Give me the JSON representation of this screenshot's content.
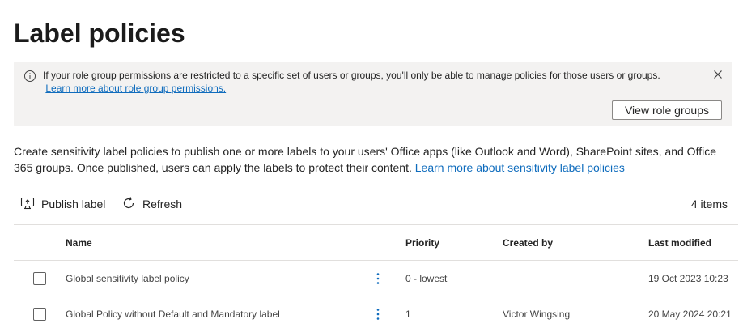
{
  "page": {
    "title": "Label policies"
  },
  "info_bar": {
    "text": "If your role group permissions are restricted to a specific set of users or groups, you'll only be able to manage policies for those users or groups.",
    "link": "Learn more about role group permissions.",
    "button": "View role groups",
    "icon": "info-icon",
    "close_icon": "close-icon"
  },
  "description": {
    "text": "Create sensitivity label policies to publish one or more labels to your users' Office apps (like Outlook and Word), SharePoint sites, and Office 365 groups. Once published, users can apply the labels to protect their content.",
    "link": "Learn more about sensitivity label policies"
  },
  "toolbar": {
    "publish_label": "Publish label",
    "publish_icon": "publish-icon",
    "refresh_label": "Refresh",
    "refresh_icon": "refresh-icon",
    "item_count": "4 items"
  },
  "table": {
    "columns": {
      "name": "Name",
      "priority": "Priority",
      "created_by": "Created by",
      "last_modified": "Last modified"
    },
    "rows": [
      {
        "name": "Global sensitivity label policy",
        "priority": "0 - lowest",
        "created_by": "",
        "last_modified": "19 Oct 2023 10:23"
      },
      {
        "name": "Global Policy without Default and Mandatory label",
        "priority": "1",
        "created_by": "Victor Wingsing",
        "last_modified": "20 May 2024 20:21"
      }
    ]
  },
  "colors": {
    "link": "#0f6cbd",
    "info_bar_bg": "#f3f2f1",
    "divider": "#e1dfdd"
  }
}
